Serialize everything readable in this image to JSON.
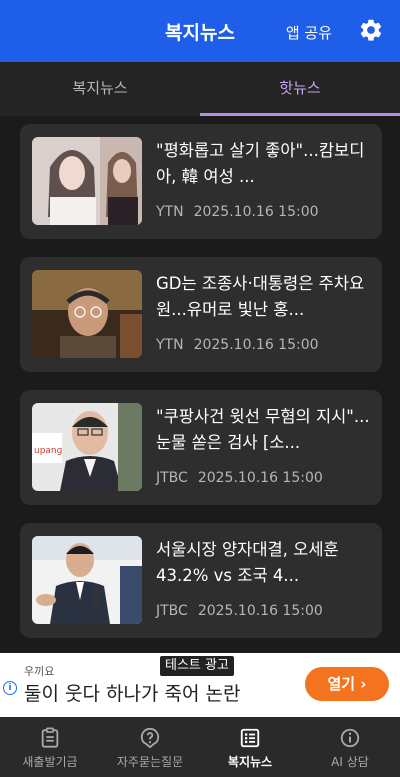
{
  "header": {
    "title": "복지뉴스",
    "share_label": "앱 공유",
    "settings_icon": "gear-icon"
  },
  "tabs": [
    {
      "label": "복지뉴스",
      "selected": false
    },
    {
      "label": "핫뉴스",
      "selected": true
    }
  ],
  "news": [
    {
      "title": "\"평화롭고 살기 좋아\"...캄보디아, 韓 여성 ...",
      "source": "YTN",
      "date": "2025.10.16 15:00"
    },
    {
      "title": "GD는 조종사·대통령은 주차요원...유머로 빛난 홍...",
      "source": "YTN",
      "date": "2025.10.16 15:00"
    },
    {
      "title": "\"쿠팡사건 윗선 무혐의 지시\"...눈물 쏟은 검사 [소...",
      "source": "JTBC",
      "date": "2025.10.16 15:00"
    },
    {
      "title": "서울시장 양자대결, 오세훈 43.2% vs 조국 4...",
      "source": "JTBC",
      "date": "2025.10.16 15:00"
    }
  ],
  "ad": {
    "label": "테스트 광고",
    "source": "우끼요",
    "headline": "둘이 웃다 하나가 죽어 논란",
    "cta": "열기 ›"
  },
  "bottom_nav": [
    {
      "label": "새출발기금",
      "icon": "clipboard-icon",
      "active": false
    },
    {
      "label": "자주묻는질문",
      "icon": "question-icon",
      "active": false
    },
    {
      "label": "복지뉴스",
      "icon": "list-icon",
      "active": true
    },
    {
      "label": "AI 상담",
      "icon": "info-icon",
      "active": false
    }
  ],
  "colors": {
    "header": "#1f5ee8",
    "accent": "#b48ce6",
    "cta": "#f4731f"
  }
}
